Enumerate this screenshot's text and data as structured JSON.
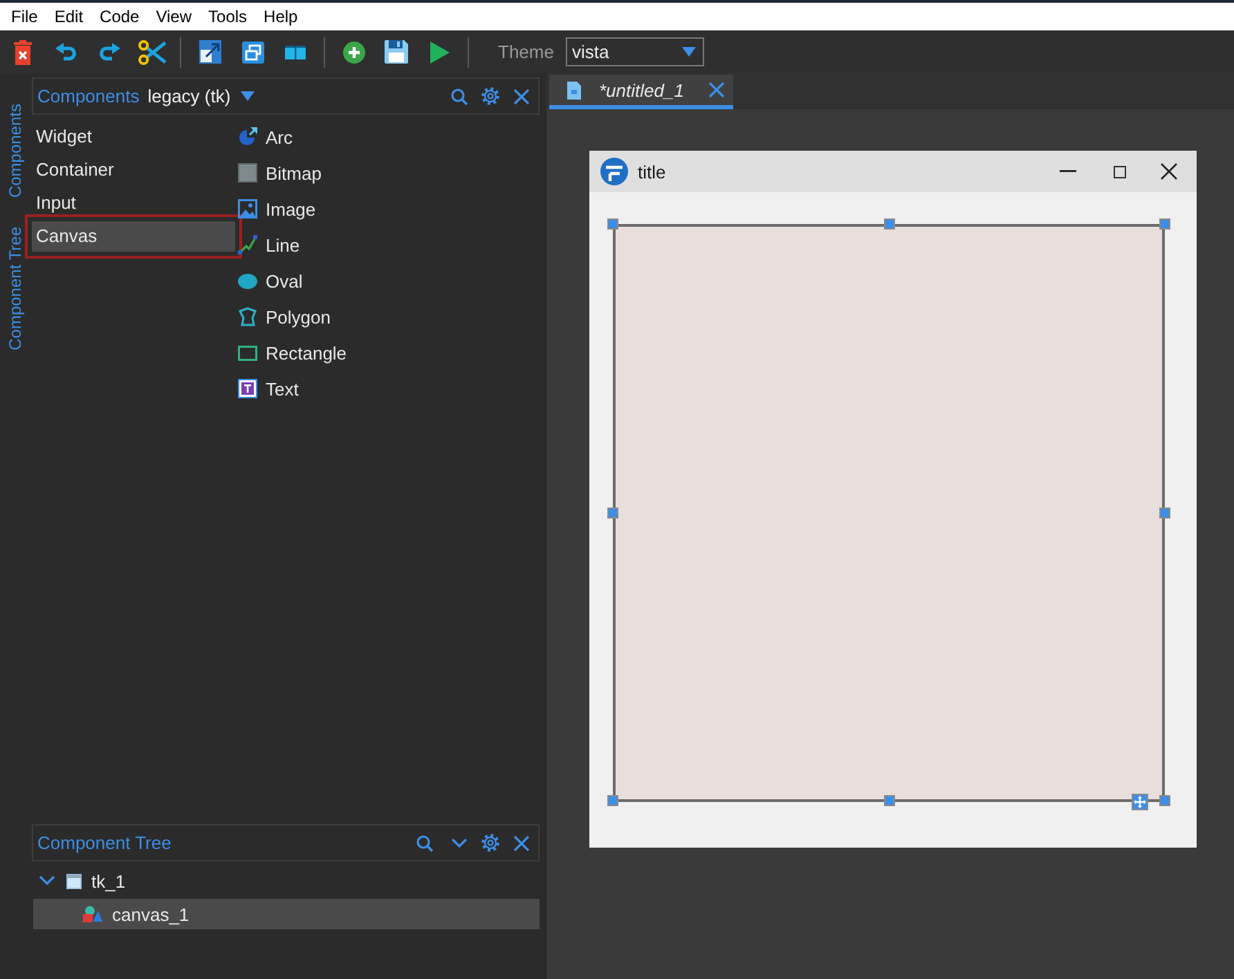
{
  "menu_bar": {
    "items": [
      "File",
      "Edit",
      "Code",
      "View",
      "Tools",
      "Help"
    ]
  },
  "toolbar": {
    "theme": {
      "label": "Theme",
      "value": "vista"
    }
  },
  "side_tabs": [
    {
      "label": "Components"
    },
    {
      "label": "Component Tree"
    }
  ],
  "components_panel": {
    "title": "Components",
    "library": "legacy (tk)",
    "categories": [
      {
        "label": "Widget",
        "selected": false
      },
      {
        "label": "Container",
        "selected": false
      },
      {
        "label": "Input",
        "selected": false
      },
      {
        "label": "Canvas",
        "selected": true
      }
    ],
    "items": [
      {
        "label": "Arc",
        "kind": "arc"
      },
      {
        "label": "Bitmap",
        "kind": "bitmap"
      },
      {
        "label": "Image",
        "kind": "image"
      },
      {
        "label": "Line",
        "kind": "line"
      },
      {
        "label": "Oval",
        "kind": "oval"
      },
      {
        "label": "Polygon",
        "kind": "polygon"
      },
      {
        "label": "Rectangle",
        "kind": "rectangle"
      },
      {
        "label": "Text",
        "kind": "text"
      }
    ]
  },
  "component_tree": {
    "title": "Component Tree",
    "nodes": [
      {
        "label": "tk_1",
        "kind": "window",
        "expanded": true,
        "selected": false,
        "children": [
          {
            "label": "canvas_1",
            "kind": "canvas",
            "selected": true
          }
        ]
      }
    ]
  },
  "editor": {
    "tabs": [
      {
        "label": "*untitled_1",
        "selected": true
      }
    ],
    "preview": {
      "title": "title",
      "canvas": {
        "selected": true
      }
    }
  }
}
